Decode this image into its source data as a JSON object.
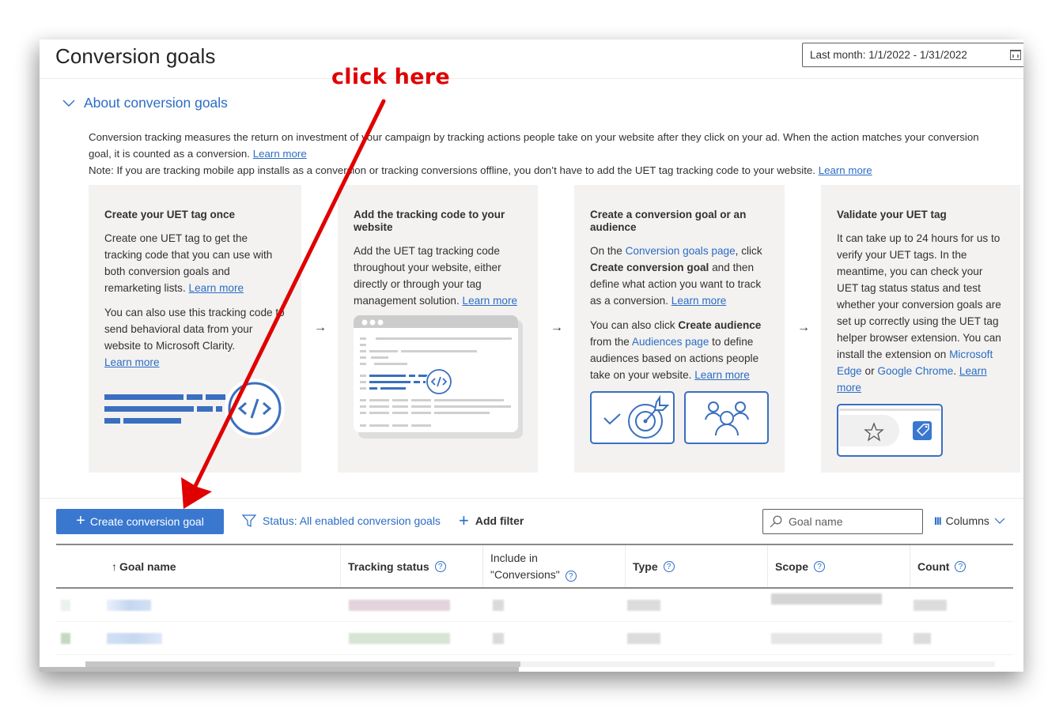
{
  "header": {
    "title": "Conversion goals",
    "date_range": "Last month: 1/1/2022 - 1/31/2022",
    "date_icon": "calendar-icon"
  },
  "annotation": {
    "text": "click here",
    "color": "#e00000"
  },
  "about": {
    "toggle_label": "About conversion goals",
    "intro_line1": "Conversion tracking measures the return on investment of your campaign by tracking actions people take on your website after they click on your ad. When the action matches your conversion goal, it is counted as a conversion.",
    "intro_line2": "Note: If you are tracking mobile app installs as a conversion or tracking conversions offline, you don’t have to add the UET tag tracking code to your website.",
    "learn_more": "Learn more"
  },
  "steps": [
    {
      "title": "Create your UET tag once",
      "p1": "Create one UET tag to get the tracking code that you can use with both conversion goals and remarketing lists.",
      "p2": "You can also use this tracking code to send behavioral data from your website to Microsoft Clarity.",
      "learn_more": "Learn more"
    },
    {
      "title": "Add the tracking code to your website",
      "p1": "Add the UET tag tracking code throughout your website, either directly or through your tag management solution.",
      "learn_more": "Learn more"
    },
    {
      "title": "Create a conversion goal or an audience",
      "p1_a": "On the ",
      "p1_link": "Conversion goals page",
      "p1_b": ", click ",
      "p1_bold": "Create conversion goal",
      "p1_c": " and then define what action you want to track as a conversion.",
      "p2_a": "You can also click ",
      "p2_bold": "Create audience",
      "p2_b": " from the ",
      "p2_link": "Audiences page",
      "p2_c": " to define audiences based on actions people take on your website.",
      "learn_more": "Learn more"
    },
    {
      "title": "Validate your UET tag",
      "p1": "It can take up to 24 hours for us to verify your UET tags. In the meantime, you can check your UET tag status status and test whether your conversion goals are set up correctly using the UET tag helper browser extension. You can install the extension on ",
      "link_edge": "Microsoft Edge",
      "or": " or ",
      "link_chrome": "Google Chrome",
      "dot": ".",
      "learn_more": "Learn more"
    }
  ],
  "step_arrow": "→",
  "toolbar": {
    "create_button": "Create conversion goal",
    "status_filter": "Status: All enabled conversion goals",
    "add_filter": "Add filter",
    "search_placeholder": "Goal name",
    "columns_label": "Columns"
  },
  "table": {
    "sort_indicator": "↑",
    "columns": [
      {
        "label": "Goal name",
        "help": false
      },
      {
        "label": "Tracking status",
        "help": true
      },
      {
        "label_line1": "Include in",
        "label_line2": "\"Conversions\"",
        "help": true
      },
      {
        "label": "Type",
        "help": true
      },
      {
        "label": "Scope",
        "help": true
      },
      {
        "label": "Count",
        "help": true
      }
    ],
    "help_glyph": "?",
    "rows_note": "2 rows, contents pixelated/redacted",
    "row_status_colors": [
      "#e3d3da",
      "#d6e6d3"
    ]
  },
  "colors": {
    "accent": "#2b6cc4",
    "primary_button": "#3a78d0",
    "card_bg": "#f3f2f1"
  }
}
